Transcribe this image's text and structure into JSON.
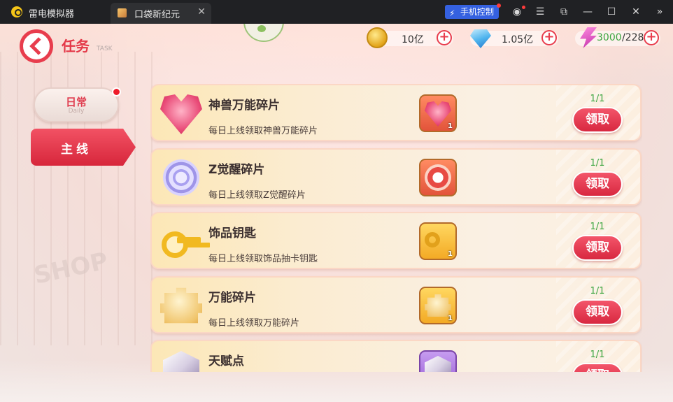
{
  "window": {
    "app_name": "雷电模拟器",
    "tab_title": "口袋新纪元",
    "tab_close": "✕",
    "phone_control": "手机控制",
    "icons": [
      "app-logo-icon",
      "user-icon",
      "menu-icon",
      "resize-icon",
      "minimize-icon",
      "maximize-icon",
      "close-icon",
      "collapse-icon"
    ]
  },
  "header": {
    "title": "任务",
    "subtitle": "TASK",
    "resources": {
      "coin": "10亿",
      "gem": "1.05亿",
      "energy_current": "3000",
      "energy_max": "/228"
    }
  },
  "side_tabs": {
    "daily_label": "日常",
    "daily_sub": "Daily",
    "main_label": "主线"
  },
  "tasks": [
    {
      "name": "神兽万能碎片",
      "desc": "每日上线领取神兽万能碎片",
      "reward_qty": "1",
      "progress": "1/1",
      "button": "领取"
    },
    {
      "name": "Z觉醒碎片",
      "desc": "每日上线领取Z觉醒碎片",
      "reward_qty": "",
      "progress": "1/1",
      "button": "领取"
    },
    {
      "name": "饰品钥匙",
      "desc": "每日上线领取饰品抽卡钥匙",
      "reward_qty": "1",
      "progress": "1/1",
      "button": "领取"
    },
    {
      "name": "万能碎片",
      "desc": "每日上线领取万能碎片",
      "reward_qty": "1",
      "progress": "1/1",
      "button": "领取"
    },
    {
      "name": "天赋点",
      "desc": "",
      "reward_qty": "",
      "progress": "1/1",
      "button": "领取"
    }
  ],
  "colors": {
    "accent": "#e43848",
    "progress": "#3ba53f",
    "titlebar": "#202124",
    "phone_control": "#3561e0"
  }
}
